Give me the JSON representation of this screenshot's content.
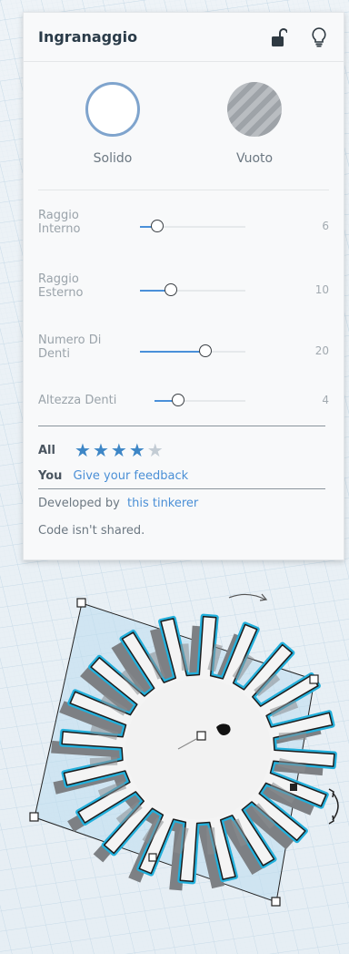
{
  "panel": {
    "title": "Ingranaggio",
    "lock_icon": "lock-open-icon",
    "bulb_icon": "lightbulb-icon"
  },
  "modes": {
    "solid": {
      "label": "Solido",
      "selected": true
    },
    "hole": {
      "label": "Vuoto",
      "selected": false
    }
  },
  "sliders": [
    {
      "label": "Raggio Interno",
      "value": "6",
      "fraction": 0.16
    },
    {
      "label": "Raggio Esterno",
      "value": "10",
      "fraction": 0.29
    },
    {
      "label": "Numero Di Denti",
      "value": "20",
      "fraction": 0.62
    },
    {
      "label": "Altezza Denti",
      "value": "4",
      "fraction": 0.26
    }
  ],
  "rating": {
    "all_label": "All",
    "stars": 4,
    "max_stars": 5,
    "you_label": "You",
    "feedback_link": "Give your feedback"
  },
  "developer": {
    "prefix": "Developed by",
    "link": "this tinkerer"
  },
  "code_note": "Code isn't shared.",
  "colors": {
    "accent": "#4a90d9",
    "star_filled": "#3d86c6",
    "star_empty": "#c3ccd4",
    "gear_outline": "#22b0dc"
  }
}
